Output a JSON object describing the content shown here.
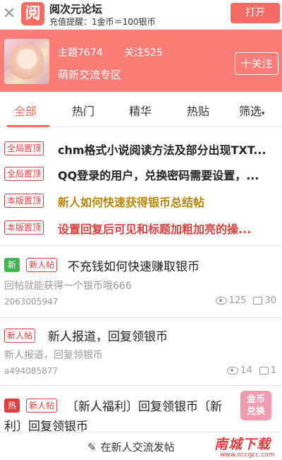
{
  "app_banner": {
    "close_symbol": "✕",
    "logo_char": "阅",
    "app_name": "阅次元论坛",
    "tip": "充值提醒：1金币＝100银币",
    "open_label": "打开"
  },
  "forum": {
    "topics": "主题7674",
    "follows": "关注525",
    "name": "萌新交流专区",
    "follow_label": "十关注"
  },
  "tabs": [
    {
      "label": "全部",
      "active": true
    },
    {
      "label": "热门"
    },
    {
      "label": "精华"
    },
    {
      "label": "热贴"
    },
    {
      "label": "筛选"
    }
  ],
  "pinned": [
    {
      "badge": "全局置顶",
      "title": "chm格式小说阅读方法及部分出现TXT...",
      "color": "#222222"
    },
    {
      "badge": "全局置顶",
      "title": "QQ登录的用户，兑换密码需要设置，...",
      "color": "#222222"
    },
    {
      "badge": "本版置顶",
      "title": "新人如何快速获得银币总结帖",
      "color": "#b8860b"
    },
    {
      "badge": "本版置顶",
      "title": "设置回复后可见和标题加粗加亮的操...",
      "color": "#e23d3d"
    }
  ],
  "posts": [
    {
      "tag1": "新",
      "tag2": "新人帖",
      "title": "不充钱如何快速赚取银币",
      "excerpt": "回帖就能获得一个银币哦666",
      "author": "2063005947",
      "views": "125",
      "replies": "30"
    },
    {
      "tag2": "新人帖",
      "title": "新人报道，回复领银币",
      "excerpt": "新人报道，回复领银币",
      "author": "a494085877",
      "views": "14",
      "replies": "1"
    },
    {
      "tag1": "热",
      "tag2": "新人帖",
      "title": "〔新人福利〕回复领银币〔新",
      "title_line2": "利〕回复领银币"
    }
  ],
  "float_badge": {
    "line1": "金币",
    "line2": "兑换"
  },
  "bottom": {
    "compose_icon": "✎",
    "compose_label": "在新人交流发帖"
  },
  "watermark": {
    "line1": "南城下载",
    "line2": "www.nccgcc.com"
  }
}
